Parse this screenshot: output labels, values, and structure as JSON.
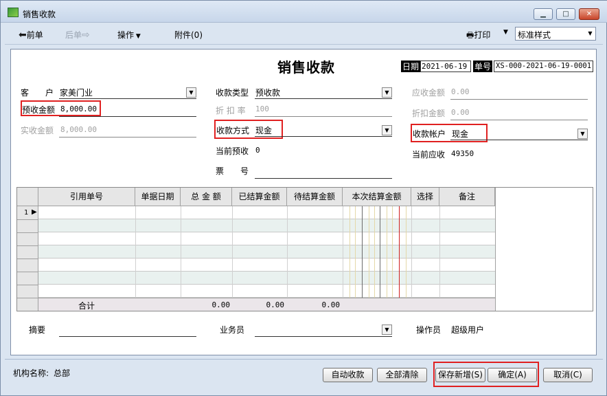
{
  "window": {
    "title": "销售收款"
  },
  "toolbar": {
    "prev_label": "前单",
    "next_label": "后单",
    "ops_label": "操作",
    "attach_label": "附件(0)",
    "print_label": "打印",
    "style_value": "标准样式"
  },
  "header": {
    "title": "销售收款",
    "date_label": "日期",
    "date_value": "2021-06-19",
    "no_label": "单号",
    "no_value": "XS-000-2021-06-19-0001"
  },
  "fields": {
    "customer_label": "客　　户",
    "customer_value": "家美门业",
    "prepay_label": "预收金额",
    "prepay_value": "8,000.00",
    "actual_label": "实收金额",
    "actual_value": "8,000.00",
    "type_label": "收款类型",
    "type_value": "预收款",
    "discount_rate_label": "折 扣 率",
    "discount_rate_value": "100",
    "method_label": "收款方式",
    "method_value": "现金",
    "current_prepay_label": "当前预收",
    "current_prepay_value": "0",
    "ticket_label": "票　　号",
    "receivable_label": "应收金额",
    "receivable_value": "0.00",
    "discount_amount_label": "折扣金额",
    "discount_amount_value": "0.00",
    "account_label": "收款帐户",
    "account_value": "现金",
    "current_receivable_label": "当前应收",
    "current_receivable_value": "49350"
  },
  "grid": {
    "columns": [
      "引用单号",
      "单据日期",
      "总 金 额",
      "已结算金额",
      "待结算金额",
      "本次结算金额",
      "选择",
      "备注"
    ],
    "first_row_number": "1",
    "total_label": "合计",
    "total_amount": "0.00",
    "total_settled": "0.00",
    "total_pending": "0.00"
  },
  "footer": {
    "summary_label": "摘要",
    "salesperson_label": "业务员",
    "operator_label": "操作员",
    "operator_value": "超级用户"
  },
  "statusbar": {
    "org_label": "机构名称:",
    "org_value": "总部",
    "auto_btn": "自动收款",
    "clear_btn": "全部清除",
    "save_new_btn": "保存新增(S)",
    "ok_btn": "确定(A)",
    "cancel_btn": "取消(C)"
  }
}
